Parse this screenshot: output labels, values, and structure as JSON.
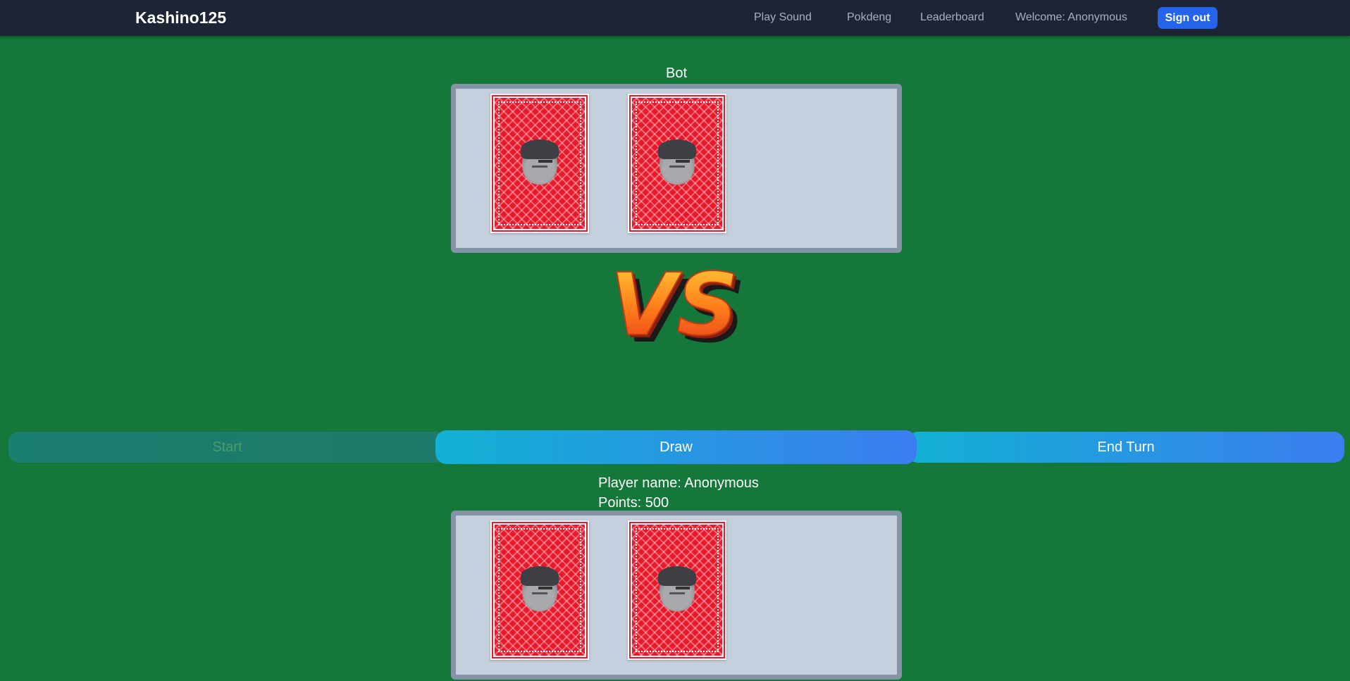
{
  "navbar": {
    "brand": "Kashino125",
    "links": [
      "Play Sound",
      "Pokdeng",
      "Leaderboard"
    ],
    "welcome": "Welcome: Anonymous",
    "signout_label": "Sign out"
  },
  "bot": {
    "label": "Bot",
    "cards": [
      "card-back",
      "card-back"
    ]
  },
  "vs": {
    "text": "VS"
  },
  "actions": {
    "start_label": "Start",
    "start_disabled": true,
    "draw_label": "Draw",
    "end_turn_label": "End Turn"
  },
  "player": {
    "name_line": "Player name: Anonymous",
    "points_line": "Points: 500",
    "cards": [
      "card-back",
      "card-back"
    ]
  },
  "colors": {
    "table_green": "#15773a",
    "navbar": "#1d2433",
    "signout": "#2563eb",
    "card_red": "#e8192a",
    "hand_bg": "#c4d0dd",
    "hand_border": "#8593a6"
  }
}
